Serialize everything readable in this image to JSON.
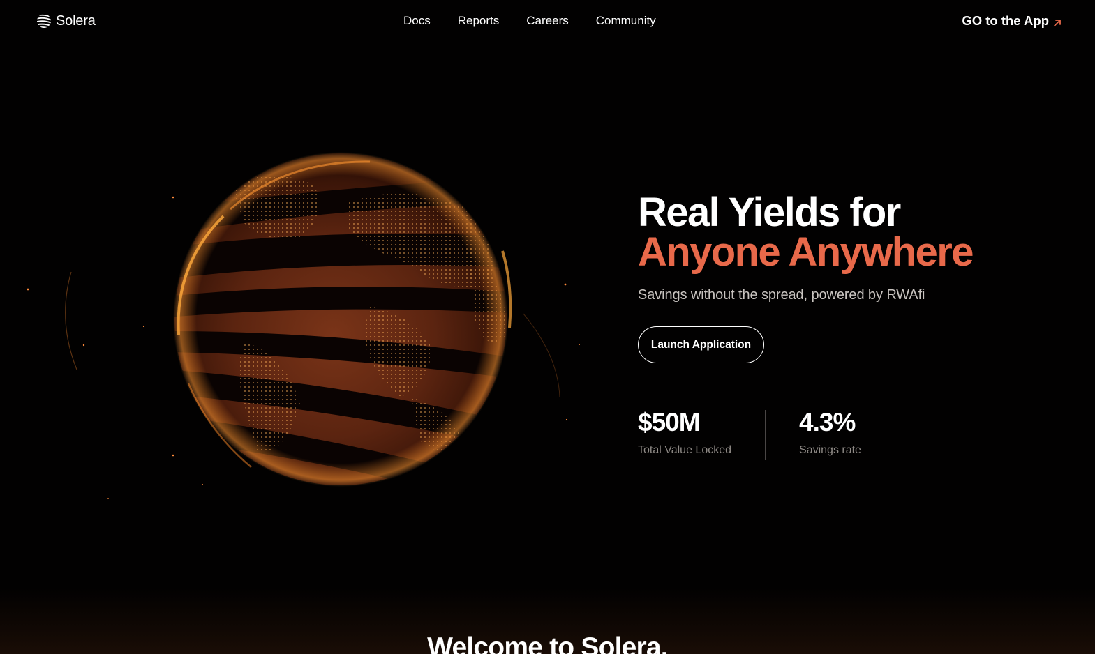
{
  "brand": {
    "name": "Solera"
  },
  "nav": {
    "items": [
      {
        "label": "Docs"
      },
      {
        "label": "Reports"
      },
      {
        "label": "Careers"
      },
      {
        "label": "Community"
      }
    ],
    "cta_label": "GO to the App",
    "cta_icon": "arrow-up-right-icon"
  },
  "hero": {
    "title_line1": "Real Yields for",
    "title_line2": "Anyone Anywhere",
    "subtitle": "Savings without the spread, powered by RWAfi",
    "button_label": "Launch Application"
  },
  "stats": [
    {
      "value": "$50M",
      "label": "Total Value Locked"
    },
    {
      "value": "4.3%",
      "label": "Savings rate"
    }
  ],
  "welcome": {
    "heading": "Welcome to Solera."
  },
  "colors": {
    "background": "#020101",
    "accent": "#e8694a",
    "globe_orange": "#d2581f"
  }
}
